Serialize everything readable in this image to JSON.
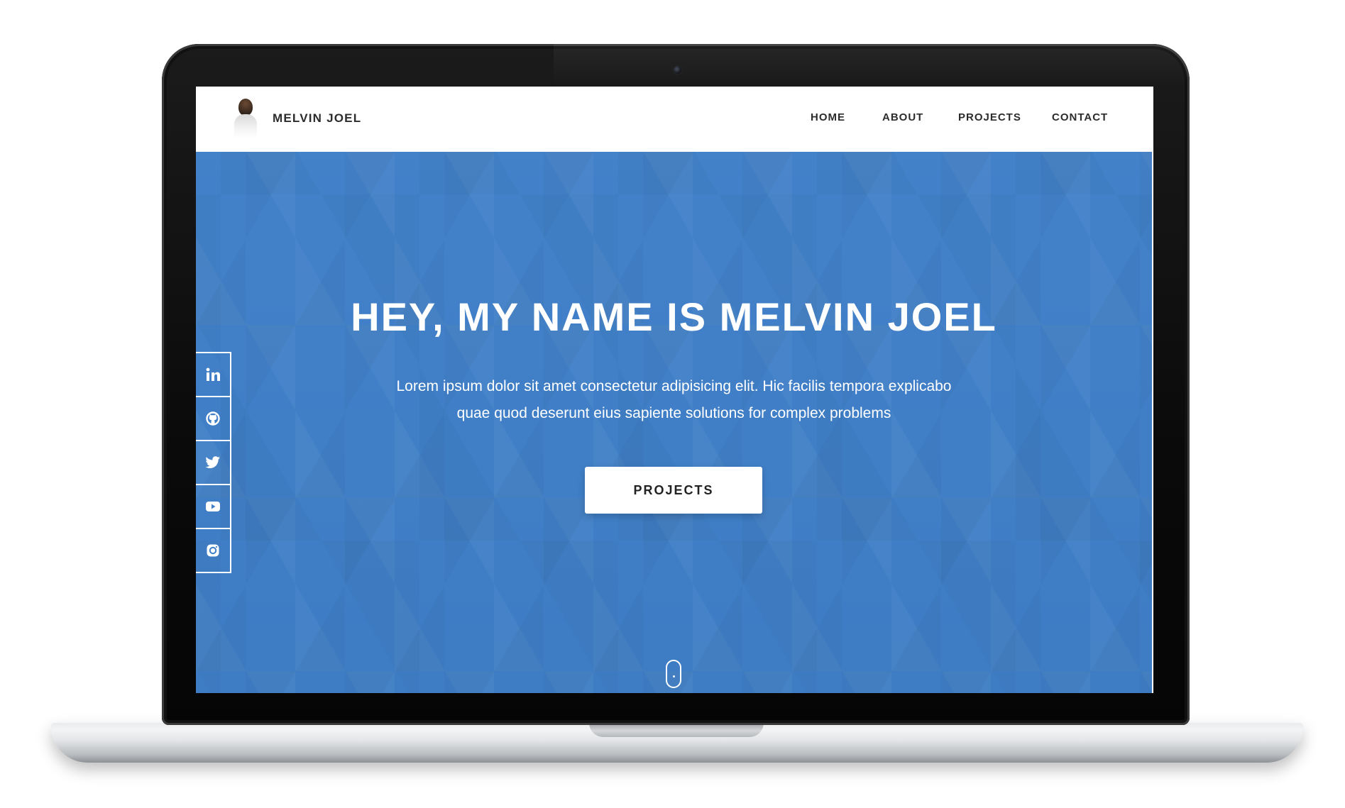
{
  "navbar": {
    "brand_name": "MELVIN JOEL",
    "links": [
      {
        "label": "HOME"
      },
      {
        "label": "ABOUT"
      },
      {
        "label": "PROJECTS"
      },
      {
        "label": "CONTACT"
      }
    ]
  },
  "hero": {
    "title": "HEY, MY NAME IS MELVIN JOEL",
    "subtitle": "Lorem ipsum dolor sit amet consectetur adipisicing elit. Hic facilis tempora explicabo quae quod deserunt eius sapiente solutions for complex problems",
    "button_label": "PROJECTS"
  },
  "social": {
    "icons": [
      "linkedin-icon",
      "github-icon",
      "twitter-icon",
      "youtube-icon",
      "instagram-icon"
    ]
  },
  "scroll_indicator": {
    "icon": "mouse-scroll-icon"
  },
  "colors": {
    "hero_background": "#3f7fc8",
    "nav_text": "#2c2c2c",
    "laptop_bezel": "#0a0a0a",
    "white": "#ffffff"
  }
}
